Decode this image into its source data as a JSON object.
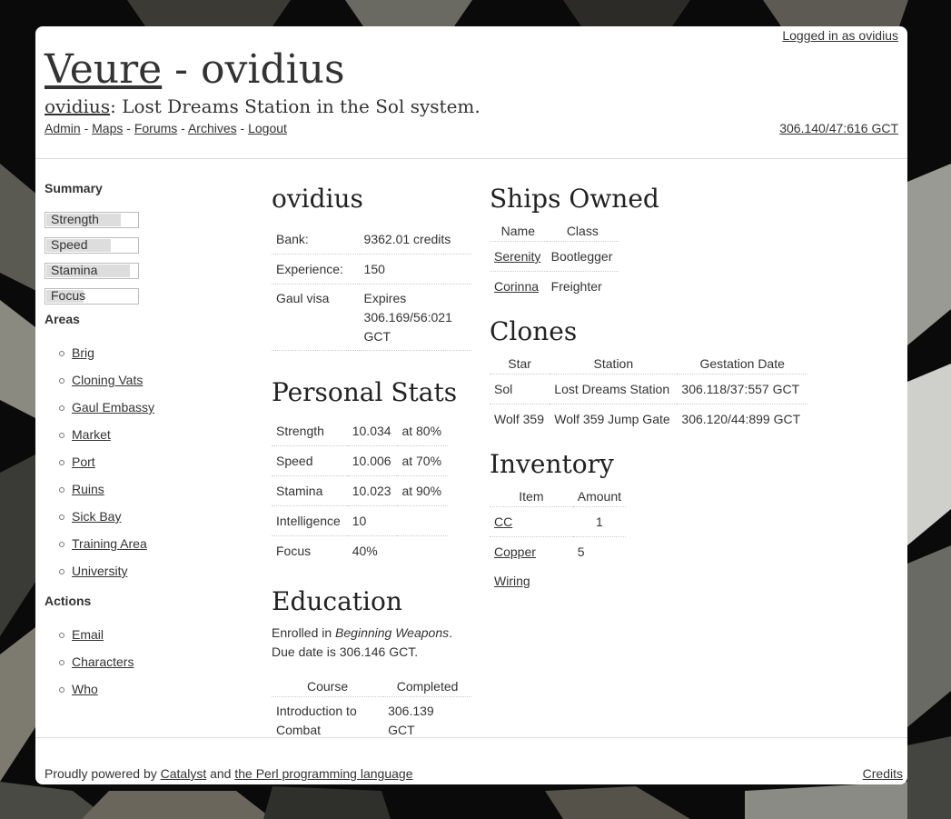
{
  "top": {
    "login": "Logged in as ovidius"
  },
  "header": {
    "site_name": "Veure",
    "title_rest": " - ovidius",
    "character": "ovidius",
    "location": ": Lost Dreams Station in the Sol system."
  },
  "nav": {
    "items": [
      "Admin",
      "Maps",
      "Forums",
      "Archives",
      "Logout"
    ],
    "separator": " - ",
    "clock": "306.140/47:616 GCT"
  },
  "sidebar": {
    "summary_title": "Summary",
    "stats": [
      {
        "label": "Strength",
        "fill": 0.8
      },
      {
        "label": "Speed",
        "fill": 0.7
      },
      {
        "label": "Stamina",
        "fill": 0.9
      },
      {
        "label": "Focus",
        "fill": 0.4
      }
    ],
    "areas_title": "Areas",
    "areas": [
      "Brig",
      "Cloning Vats",
      "Gaul Embassy",
      "Market",
      "Port",
      "Ruins",
      "Sick Bay",
      "Training Area",
      "University"
    ],
    "actions_title": "Actions",
    "actions": [
      "Email",
      "Characters",
      "Who"
    ]
  },
  "profile": {
    "name": "ovidius",
    "rows": [
      {
        "label": "Bank:",
        "value": "9362.01 credits"
      },
      {
        "label": "Experience:",
        "value": "150"
      }
    ],
    "visa_label": "Gaul visa",
    "visa_value": [
      "Expires",
      "306.169/56:021",
      "GCT"
    ]
  },
  "personal_stats": {
    "title": "Personal Stats",
    "rows": [
      {
        "name": "Strength",
        "value": "10.034",
        "level": "at 80%"
      },
      {
        "name": "Speed",
        "value": "10.006",
        "level": "at 70%"
      },
      {
        "name": "Stamina",
        "value": "10.023",
        "level": "at 90%"
      },
      {
        "name": "Intelligence",
        "value": "10",
        "level": ""
      },
      {
        "name": "Focus",
        "value": "40%",
        "level": ""
      }
    ]
  },
  "education": {
    "title": "Education",
    "enrolled_prefix": "Enrolled in ",
    "course": "Beginning Weapons",
    "enrolled_suffix": ".",
    "due": "Due date is 306.146 GCT.",
    "headers": [
      "Course",
      "Completed"
    ],
    "courses": [
      {
        "course": [
          "Introduction to",
          "Combat"
        ],
        "completed": [
          "306.139",
          "GCT"
        ]
      }
    ]
  },
  "ships": {
    "title": "Ships Owned",
    "headers": [
      "Name",
      "Class"
    ],
    "rows": [
      {
        "name": "Serenity",
        "class": "Bootlegger"
      },
      {
        "name": "Corinna",
        "class": "Freighter"
      }
    ]
  },
  "clones": {
    "title": "Clones",
    "headers": [
      "Star",
      "Station",
      "Gestation Date"
    ],
    "rows": [
      {
        "star": "Sol",
        "station": "Lost Dreams Station",
        "date": "306.118/37:557 GCT"
      },
      {
        "star": "Wolf 359",
        "station": "Wolf 359 Jump Gate",
        "date": "306.120/44:899 GCT"
      }
    ]
  },
  "inventory": {
    "title": "Inventory",
    "headers": [
      "Item",
      "Amount"
    ],
    "rows": [
      {
        "item": "CC",
        "amount": "1"
      },
      {
        "item": "Copper Wiring",
        "amount": "5"
      }
    ]
  },
  "footer": {
    "prefix": "Proudly powered by ",
    "catalyst": "Catalyst",
    "middle": " and ",
    "perl": "the Perl programming language",
    "credits": "Credits"
  }
}
